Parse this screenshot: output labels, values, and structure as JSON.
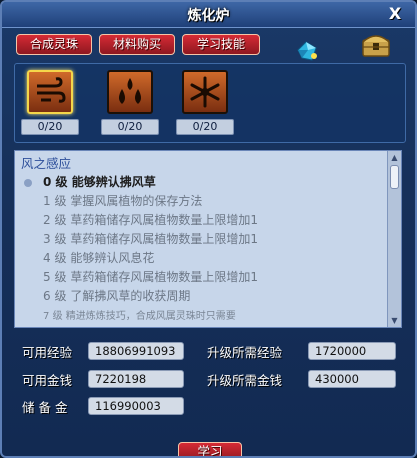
{
  "window": {
    "title": "炼化炉",
    "close_label": "X"
  },
  "tabs": [
    {
      "label": "合成灵珠"
    },
    {
      "label": "材料购买"
    },
    {
      "label": "学习技能"
    }
  ],
  "skills": [
    {
      "icon": "wind-icon",
      "count": "0/20",
      "selected": true
    },
    {
      "icon": "water-drops-icon",
      "count": "0/20",
      "selected": false
    },
    {
      "icon": "snowflake-icon",
      "count": "0/20",
      "selected": false
    }
  ],
  "skill_detail": {
    "name": "风之感应",
    "levels": [
      {
        "level": "0",
        "unit": "级",
        "text": "能够辨认拂风草"
      },
      {
        "level": "1",
        "unit": "级",
        "text": "掌握风属植物的保存方法"
      },
      {
        "level": "2",
        "unit": "级",
        "text": "草药箱储存风属植物数量上限增加1"
      },
      {
        "level": "3",
        "unit": "级",
        "text": "草药箱储存风属植物数量上限增加1"
      },
      {
        "level": "4",
        "unit": "级",
        "text": "能够辨认风息花"
      },
      {
        "level": "5",
        "unit": "级",
        "text": "草药箱储存风属植物数量上限增加1"
      },
      {
        "level": "6",
        "unit": "级",
        "text": "了解拂风草的收获周期"
      },
      {
        "level": "7",
        "unit": "级",
        "text": "精进炼炼技巧，合成风属灵珠时只需要"
      }
    ]
  },
  "stats": {
    "available_exp_label": "可用经验",
    "available_exp": "18806991093",
    "required_exp_label": "升级所需经验",
    "required_exp": "1720000",
    "available_money_label": "可用金钱",
    "available_money": "7220198",
    "required_money_label": "升级所需金钱",
    "required_money": "430000",
    "reserve_label": "储 备 金",
    "reserve": "116990003"
  },
  "learn_button": "学习",
  "colors": {
    "tab_red": "#c0222c",
    "panel_blue": "#16305a",
    "list_bg": "#c7d6ea"
  }
}
